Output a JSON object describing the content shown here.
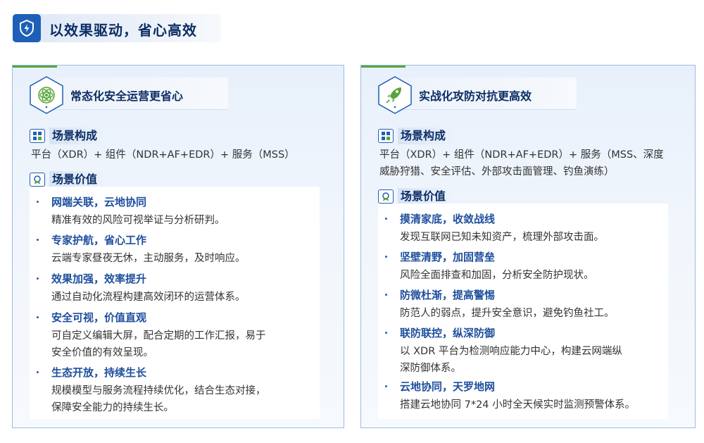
{
  "header": {
    "title": "以效果驱动，省心高效",
    "badge_icon": "shield-lightning-icon",
    "accent_color": "#1e5fb8"
  },
  "cards": [
    {
      "title": "常态化安全运营更省心",
      "title_icon": "atom-icon",
      "composition_label": "场景构成",
      "composition_icon": "grid-icon",
      "composition_text": "平台（XDR）+ 组件（NDR+AF+EDR）+ 服务（MSS）",
      "value_label": "场景价值",
      "value_icon": "medal-icon",
      "values": [
        {
          "title": "网端关联，云地协同",
          "desc": "精准有效的风险可视举证与分析研判。"
        },
        {
          "title": "专家护航，省心工作",
          "desc": "云端专家昼夜无休，主动服务，及时响应。"
        },
        {
          "title": "效果加强，效率提升",
          "desc": "通过自动化流程构建高效闭环的运营体系。"
        },
        {
          "title": "安全可视，价值直观",
          "desc_lines": [
            "可自定义编辑大屏，配合定期的工作汇报，易于",
            "安全价值的有效呈现。"
          ]
        },
        {
          "title": "生态开放，持续生长",
          "desc_lines": [
            "规模模型与服务流程持续优化，结合生态对接，",
            "保障安全能力的持续生长。"
          ]
        }
      ]
    },
    {
      "title": "实战化攻防对抗更高效",
      "title_icon": "rocket-icon",
      "composition_label": "场景构成",
      "composition_icon": "grid-icon",
      "composition_lines": [
        "平台（XDR）+ 组件（NDR+AF+EDR）+ 服务（MSS、深度",
        "威胁狩猎、安全评估、外部攻击面管理、钓鱼演练）"
      ],
      "value_label": "场景价值",
      "value_icon": "medal-icon",
      "values": [
        {
          "title": "摸清家底，收敛战线",
          "desc": "发现互联网已知未知资产，梳理外部攻击面。"
        },
        {
          "title": "坚壁清野，加固营垒",
          "desc": "风险全面排查和加固，分析安全防护现状。"
        },
        {
          "title": "防微杜渐，提高警惕",
          "desc": "防范人的弱点，提升安全意识，避免钓鱼社工。"
        },
        {
          "title": "联防联控，纵深防御",
          "desc_lines": [
            "以 XDR 平台为检测响应能力中心，构建云网端纵",
            "深防御体系。"
          ]
        },
        {
          "title": "云地协同，天罗地网",
          "desc": "搭建云地协同 7*24 小时全天候实时监测预警体系。"
        }
      ]
    }
  ]
}
